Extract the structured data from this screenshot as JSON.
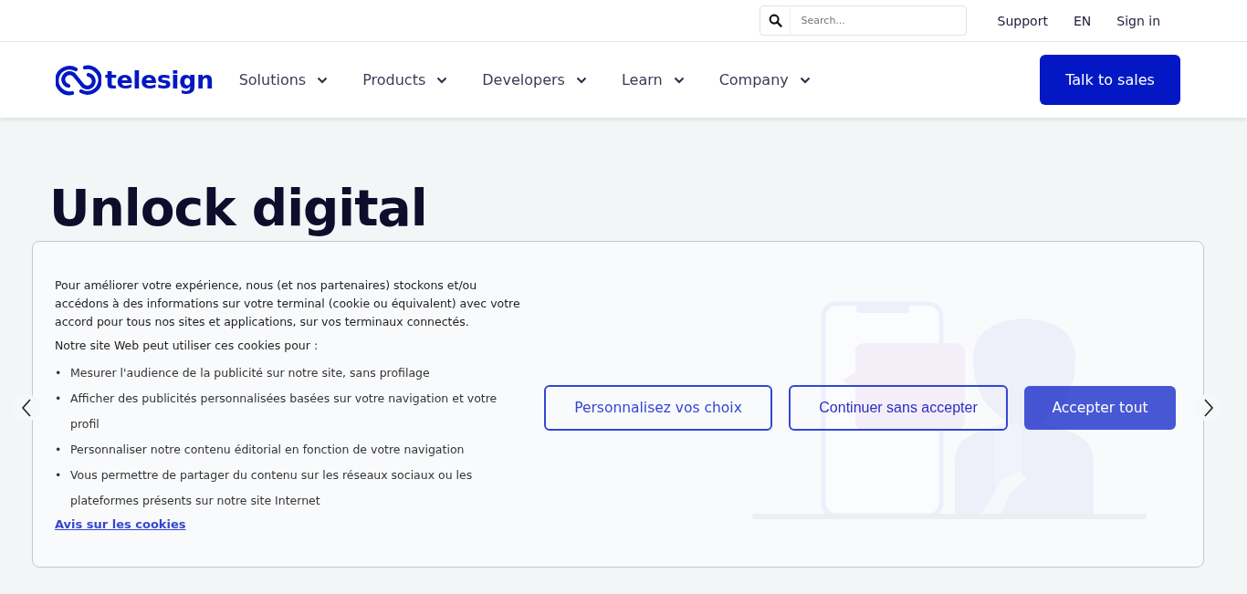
{
  "top_bar": {
    "search": {
      "placeholder": "Search..."
    },
    "links": [
      "Support",
      "EN",
      "Sign in"
    ]
  },
  "nav": {
    "logo": "telesign",
    "items": [
      {
        "label": "Solutions"
      },
      {
        "label": "Products"
      },
      {
        "label": "Developers"
      },
      {
        "label": "Learn"
      },
      {
        "label": "Company"
      }
    ],
    "cta": "Talk to sales"
  },
  "hero": {
    "title": "Unlock digital"
  },
  "cookie_banner": {
    "intro": "Pour améliorer votre expérience, nous (et nos partenaires) stockons et/ou accédons à des informations sur votre terminal (cookie ou équivalent) avec votre accord pour tous nos sites et applications, sur vos terminaux connectés.",
    "purpose_heading": "Notre site Web peut utiliser ces cookies pour :",
    "bullet": "•",
    "purposes": [
      "Mesurer l'audience de la publicité sur notre site, sans profilage",
      "Afficher des publicités personnalisées basées sur votre navigation et votre profil",
      "Personnaliser notre contenu éditorial en fonction de votre navigation",
      "Vous permettre de partager du contenu sur les réseaux sociaux ou les plateformes présents sur notre site Internet"
    ],
    "link": "Avis sur les cookies",
    "buttons": [
      {
        "label": "Personnalisez vos choix",
        "kind": "outline"
      },
      {
        "label": "Continuer sans accepter",
        "kind": "plain-outline"
      },
      {
        "label": "Accepter tout",
        "kind": "primary"
      }
    ]
  }
}
